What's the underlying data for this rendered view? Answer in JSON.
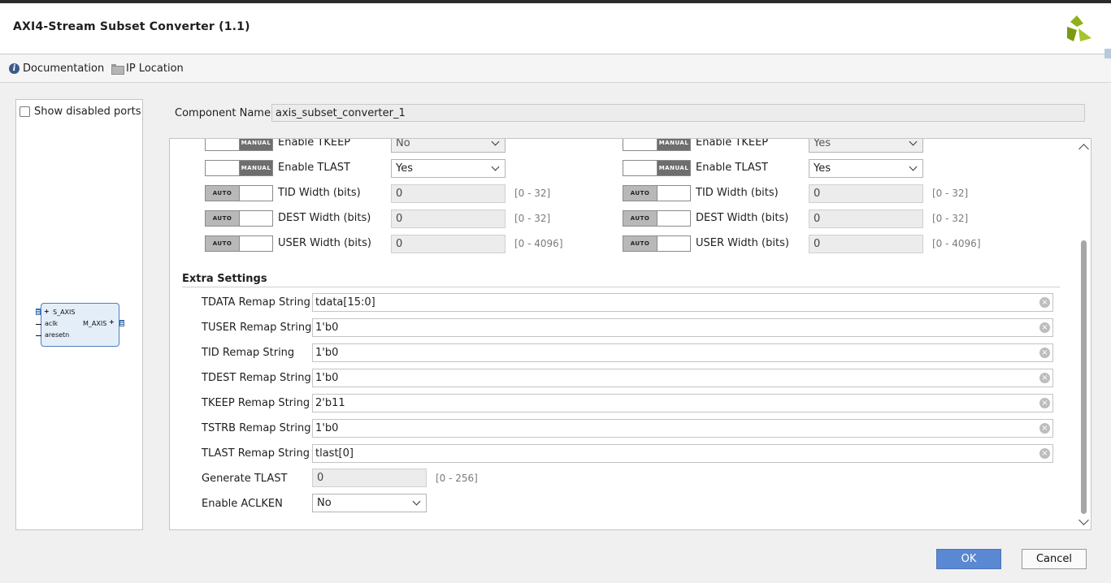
{
  "window": {
    "title": "AXI4-Stream Subset Converter (1.1)"
  },
  "links": {
    "documentation": "Documentation",
    "ip_location": "IP Location"
  },
  "left_panel": {
    "show_disabled_ports": "Show disabled ports",
    "block": {
      "s_axis": "S_AXIS",
      "aclk": "aclk",
      "aresetn": "aresetn",
      "m_axis": "M_AXIS"
    }
  },
  "component": {
    "label": "Component Name",
    "value": "axis_subset_converter_1"
  },
  "slave": {
    "rows": [
      {
        "toggle": "MANUAL",
        "label": "Enable TKEEP",
        "value": "No",
        "kind": "select"
      },
      {
        "toggle": "MANUAL",
        "label": "Enable TLAST",
        "value": "Yes",
        "kind": "select"
      },
      {
        "toggle": "AUTO",
        "label": "TID Width (bits)",
        "value": "0",
        "range": "[0 - 32]",
        "kind": "num"
      },
      {
        "toggle": "AUTO",
        "label": "DEST Width (bits)",
        "value": "0",
        "range": "[0 - 32]",
        "kind": "num"
      },
      {
        "toggle": "AUTO",
        "label": "USER Width (bits)",
        "value": "0",
        "range": "[0 - 4096]",
        "kind": "num"
      }
    ]
  },
  "master": {
    "rows": [
      {
        "toggle": "MANUAL",
        "label": "Enable TKEEP",
        "value": "Yes",
        "kind": "select"
      },
      {
        "toggle": "MANUAL",
        "label": "Enable TLAST",
        "value": "Yes",
        "kind": "select"
      },
      {
        "toggle": "AUTO",
        "label": "TID Width (bits)",
        "value": "0",
        "range": "[0 - 32]",
        "kind": "num"
      },
      {
        "toggle": "AUTO",
        "label": "DEST Width (bits)",
        "value": "0",
        "range": "[0 - 32]",
        "kind": "num"
      },
      {
        "toggle": "AUTO",
        "label": "USER Width (bits)",
        "value": "0",
        "range": "[0 - 4096]",
        "kind": "num"
      }
    ]
  },
  "toggle_text": {
    "auto": "AUTO",
    "manual": "MANUAL"
  },
  "extra": {
    "title": "Extra Settings",
    "remaps": [
      {
        "label": "TDATA Remap String",
        "value": "tdata[15:0]"
      },
      {
        "label": "TUSER Remap String",
        "value": "1'b0"
      },
      {
        "label": "TID Remap String",
        "value": "1'b0"
      },
      {
        "label": "TDEST Remap String",
        "value": "1'b0"
      },
      {
        "label": "TKEEP Remap String",
        "value": "2'b11"
      },
      {
        "label": "TSTRB Remap String",
        "value": "1'b0"
      },
      {
        "label": "TLAST Remap String",
        "value": "tlast[0]"
      }
    ],
    "generate_tlast": {
      "label": "Generate TLAST",
      "value": "0",
      "range": "[0 - 256]"
    },
    "enable_aclken": {
      "label": "Enable ACLKEN",
      "value": "No"
    }
  },
  "buttons": {
    "ok": "OK",
    "cancel": "Cancel"
  },
  "colors": {
    "ok_button": "#5b88d2",
    "logo": "#7fa11a"
  }
}
